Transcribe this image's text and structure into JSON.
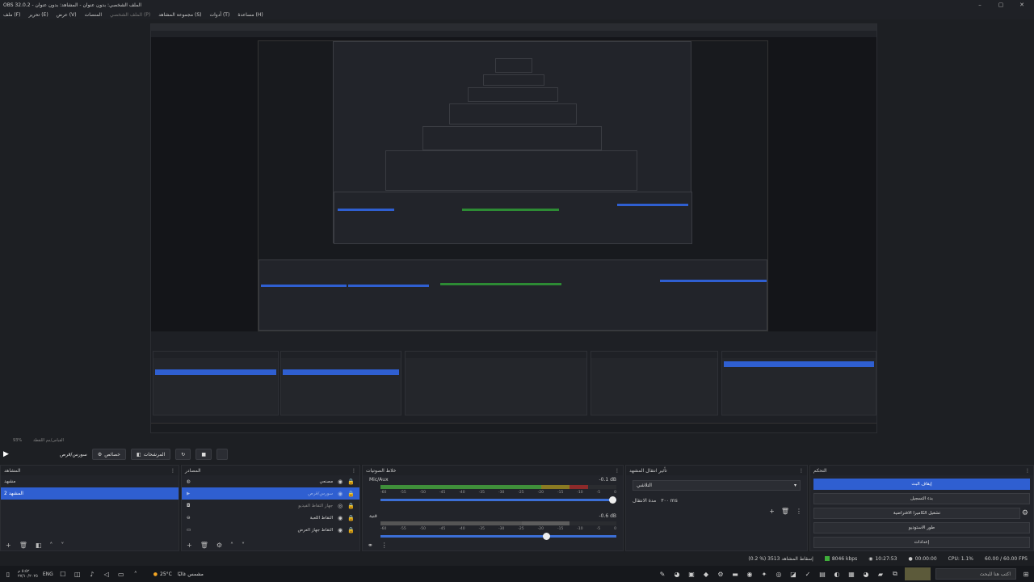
{
  "window": {
    "title": "OBS 32.0.2 - الملف الشخصي: بدون عنوان - المشاهد: بدون عنوان",
    "controls": [
      "–",
      "▢",
      "✕"
    ]
  },
  "menu": [
    "ملف (F)",
    "تحرير (E)",
    "عرض (V)",
    "المنصات",
    "الملف الشخصي (P)",
    "مجموعة المشاهد (S)",
    "أدوات (T)",
    "مساعدة (H)"
  ],
  "status_top": {
    "zoom": "93%",
    "label": "القياس/مم اللقطة"
  },
  "controls_row": {
    "source_label": "سورس/قرص",
    "properties_label": "خصائص",
    "filters_label": "المرشحات"
  },
  "scenes": {
    "title": "المشاهد",
    "items": [
      {
        "label": "مشهد"
      },
      {
        "label": "المشهد 2"
      }
    ],
    "selected": 1
  },
  "sources": {
    "title": "المصادر",
    "items": [
      {
        "label": "مصنعي",
        "icon": "globe-icon"
      },
      {
        "label": "سورس/قرص",
        "icon": "play-icon"
      },
      {
        "label": "جهاز التقاط الفيديو",
        "icon": "camera-icon"
      },
      {
        "label": "التقاط اللعبة",
        "icon": "gamepad-icon"
      },
      {
        "label": "التقاط جهاز العرض",
        "icon": "monitor-icon"
      }
    ],
    "selected": 1
  },
  "mixer": {
    "title": "خلاط الصوتيات",
    "tracks": [
      {
        "name": "Mic/Aux",
        "db": "-0.1 dB",
        "level": 0.85,
        "volume": 0.97
      },
      {
        "name": "قنية",
        "db": "-0.6 dB",
        "level": 0.8,
        "volume": 0.69
      }
    ],
    "ticks": [
      "-60",
      "-55",
      "-50",
      "-45",
      "-40",
      "-35",
      "-30",
      "-25",
      "-20",
      "-15",
      "-10",
      "-5",
      "0"
    ]
  },
  "transitions": {
    "title": "تأثير انتقال المشهد",
    "selected": "التلاشي",
    "duration_label": "مدة الانتقال",
    "duration_value": "٣٠٠ ms"
  },
  "controls_dock": {
    "title": "التحكم",
    "buttons": [
      "إيقاف البث",
      "بدء التسجيل",
      "تشغيل الكاميرا الافتراضية",
      "طور الاستوديو",
      "إعدادات"
    ]
  },
  "statusbar": {
    "dropped": "(0.2 %) 3513 إسقاط المشاهد",
    "bitrate": "8046 kbps",
    "live_time": "10:27:53",
    "rec_time": "00:00:00",
    "cpu": "CPU: 1.1%",
    "fps": "60.00 / 60.00 FPS"
  },
  "taskbar": {
    "weather": "25°C",
    "weather_text": "مشمس غالبًا",
    "lang": "ENG",
    "time": "٥:٥٢ م",
    "date": "٢٧/١٠/٢٠٢٥",
    "search_placeholder": "اكتب هنا للبحث"
  },
  "colors": {
    "accent": "#2f5fd1",
    "meter_green": "#3f8f3a",
    "meter_yellow": "#8a7a22",
    "meter_red": "#8d2a2a"
  }
}
